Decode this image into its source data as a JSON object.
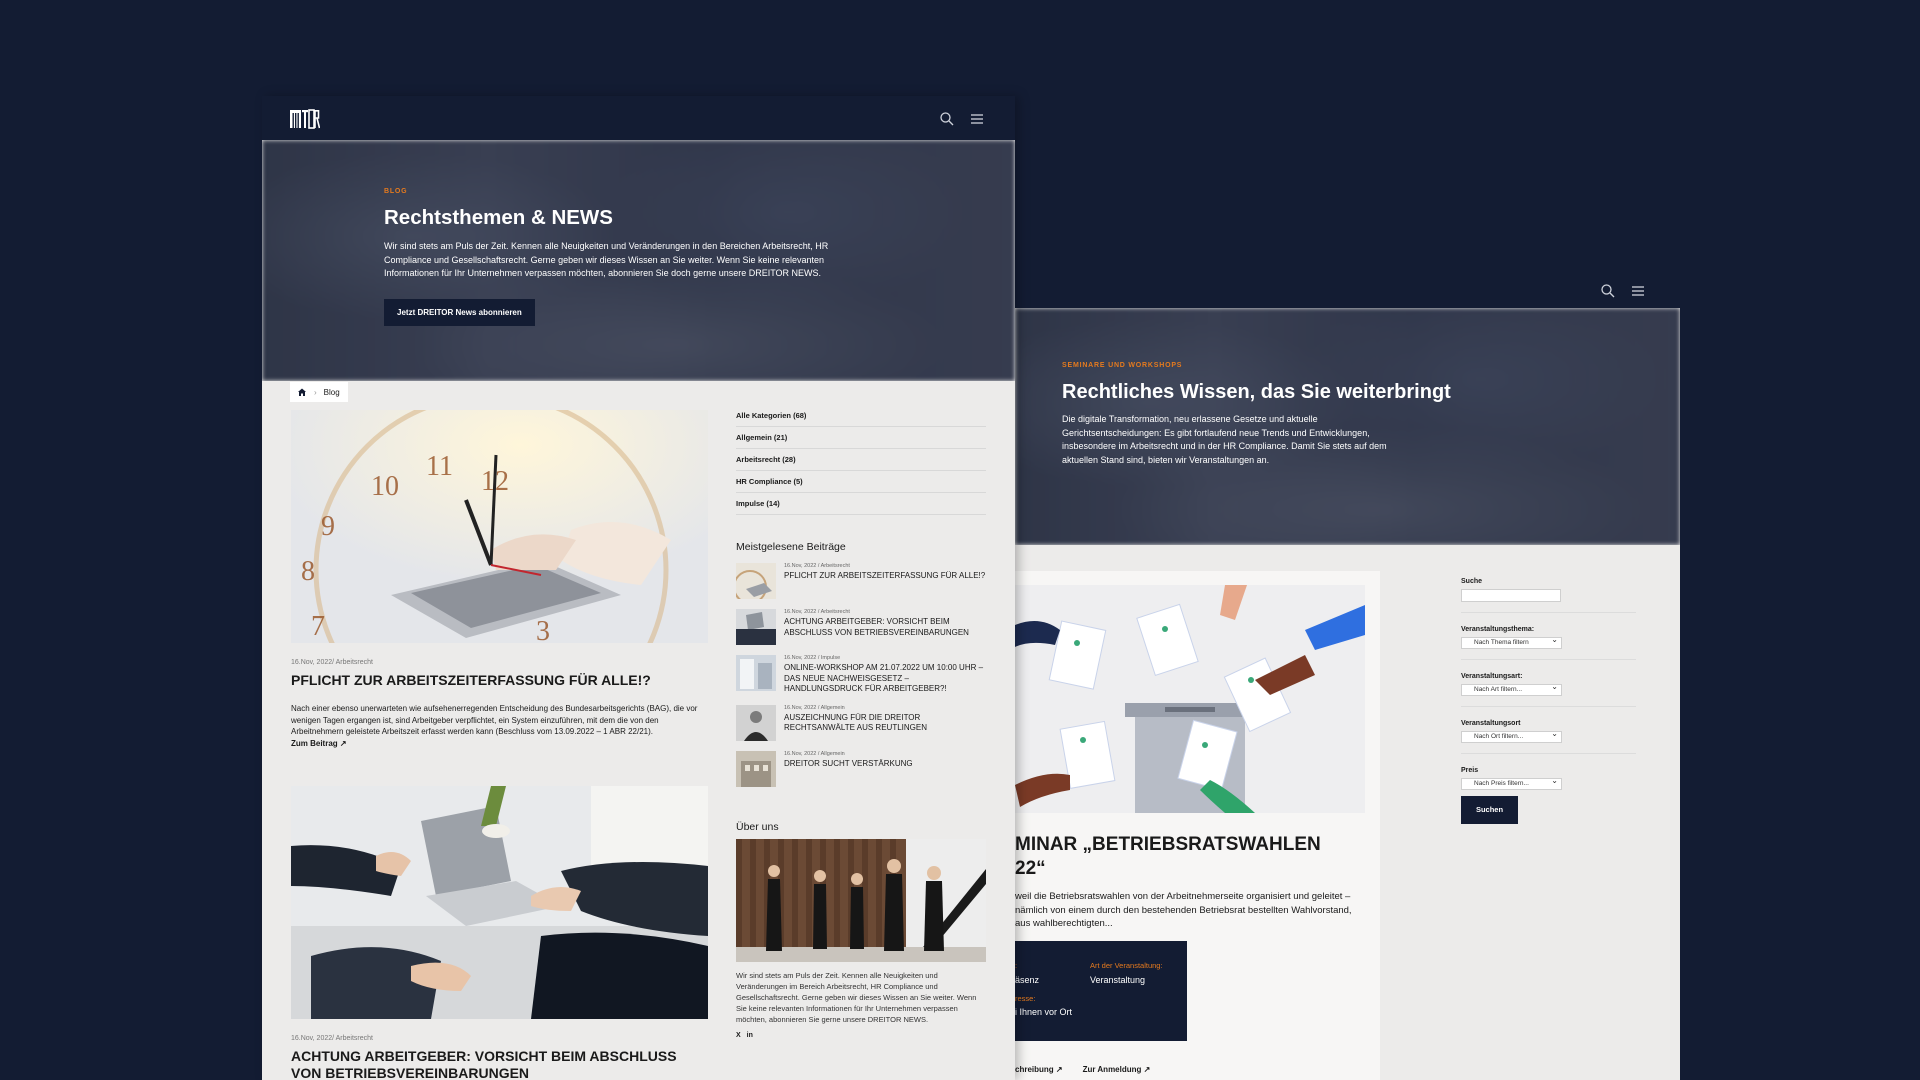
{
  "blog_page": {
    "logo_text": "DREITOR",
    "hero": {
      "eyebrow": "BLOG",
      "title": "Rechtsthemen & NEWS",
      "description": "Wir sind stets am Puls der Zeit. Kennen alle Neuigkeiten und Veränderungen in den Bereichen Arbeitsrecht, HR Compliance und Gesellschaftsrecht. Gerne geben wir dieses Wissen an Sie weiter. Wenn Sie keine relevanten Informationen für Ihr Unternehmen verpassen möchten, abonnieren Sie doch gerne unsere DREITOR NEWS.",
      "cta": "Jetzt DREITOR News abonnieren"
    },
    "breadcrumb": {
      "current": "Blog"
    },
    "posts": [
      {
        "date": "16.Nov, 2022/",
        "category": "Arbeitsrecht",
        "title": "PFLICHT ZUR ARBEITSZEITERFASSUNG FÜR ALLE!?",
        "excerpt": "Nach einer ebenso unerwarteten wie aufsehenerregenden Entscheidung des Bundesarbeitsgerichts (BAG), die vor wenigen Tagen ergangen ist, sind Arbeitgeber verpflichtet, ein System einzuführen, mit dem die von den Arbeitnehmern geleistete Arbeitszeit erfasst werden kann (Beschluss vom 13.09.2022 – 1 ABR 22/21).",
        "more": "Zum Beitrag ↗"
      },
      {
        "date": "16.Nov, 2022/",
        "category": "Arbeitsrecht",
        "title": "ACHTUNG ARBEITGEBER: VORSICHT BEIM ABSCHLUSS VON BETRIEBSVEREINBARUNGEN"
      }
    ],
    "categories": [
      "Alle Kategorien (68)",
      "Allgemein  (21)",
      "Arbeitsrecht  (28)",
      "HR Compliance  (5)",
      "Impulse  (14)"
    ],
    "popular_heading": "Meistgelesene Beiträge",
    "popular": [
      {
        "meta": "16.Nov, 2022 / Arbeitsrecht",
        "title": "PFLICHT ZUR ARBEITSZEITERFASSUNG FÜR ALLE!?"
      },
      {
        "meta": "16.Nov, 2022 / Arbeitsrecht",
        "title": "ACHTUNG ARBEITGEBER: VORSICHT BEIM ABSCHLUSS VON BETRIEBSVEREINBARUNGEN"
      },
      {
        "meta": "16.Nov, 2022 / Impulse",
        "title": "ONLINE-WORKSHOP AM 21.07.2022 UM 10:00 UHR – DAS NEUE NACHWEISGESETZ – HANDLUNGSDRUCK FÜR ARBEITGEBER?!"
      },
      {
        "meta": "16.Nov, 2022 / Allgemein",
        "title": "AUSZEICHNUNG FÜR DIE DREITOR RECHTSANWÄLTE AUS REUTLINGEN"
      },
      {
        "meta": "16.Nov, 2022 / Allgemein",
        "title": "DREITOR SUCHT VERSTÄRKUNG"
      }
    ],
    "about_heading": "Über uns",
    "about_text": "Wir sind stets am Puls der Zeit. Kennen alle Neuigkeiten und Veränderungen im Bereich Arbeitsrecht, HR Compliance und Gesellschaftsrecht. Gerne geben wir dieses Wissen an Sie weiter. Wenn Sie keine relevanten Informationen für Ihr Unternehmen verpassen möchten, abonnieren Sie gerne unsere DREITOR NEWS.",
    "social": [
      "X",
      "in"
    ]
  },
  "seminar_page": {
    "hero": {
      "eyebrow": "SEMINARE UND WORKSHOPS",
      "title": "Rechtliches Wissen, das Sie weiterbringt",
      "description": "Die digitale Transformation, neu erlassene Gesetze und aktuelle Gerichtsentscheidungen: Es gibt fortlaufend neue Trends und Entwicklungen, insbesondere im Arbeitsrecht und in der HR Compliance. Damit Sie stets auf dem aktuellen Stand sind, bieten wir Veranstaltungen an."
    },
    "card": {
      "title": "MINAR „BETRIEBSRATSWAHLEN\n22“",
      "text": "weil die Betriebsratswahlen von der Arbeitnehmerseite organisiert und geleitet – nämlich von einem durch den bestehenden Betriebsrat bestellten Wahlvorstand, aus wahlberechtigten...",
      "info": {
        "k1": ":",
        "v1": "äsenz",
        "k2": "Art der Veranstaltung:",
        "v2": "Veranstaltung",
        "k3": "resse:",
        "v3": "i Ihnen vor Ort"
      },
      "link1": "chreibung ↗",
      "link2": "Zur Anmeldung ↗"
    },
    "filters": {
      "search_label": "Suche",
      "topic_label": "Veranstaltungsthema:",
      "topic_value": "Nach Thema filtern",
      "type_label": "Veranstaltungsart:",
      "type_value": "Nach Art filtern...",
      "place_label": "Veranstaltungsort",
      "place_value": "Nach Ort filtern...",
      "price_label": "Preis",
      "price_value": "Nach Preis filtern...",
      "button": "Suchen"
    }
  },
  "colors": {
    "navy": "#131c33",
    "accent": "#e57a1e",
    "page_bg": "#ecebea"
  }
}
